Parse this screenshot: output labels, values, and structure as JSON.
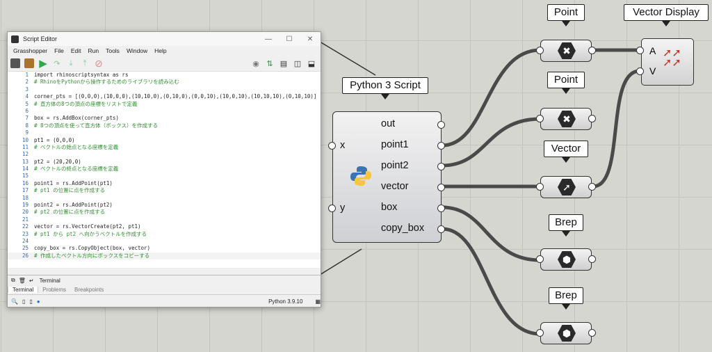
{
  "editor": {
    "title": "Script Editor",
    "menu": [
      "Grasshopper",
      "File",
      "Edit",
      "Run",
      "Tools",
      "Window",
      "Help"
    ],
    "code_lines": [
      {
        "n": "1",
        "t": "import rhinoscriptsyntax as rs"
      },
      {
        "n": "2",
        "t": "# RhinoをPythonから操作するためのライブラリを読み込む"
      },
      {
        "n": "3",
        "t": ""
      },
      {
        "n": "4",
        "t": "corner_pts = [(0,0,0),(10,0,0),(10,10,0),(0,10,0),(0,0,10),(10,0,10),(10,10,10),(0,10,10)]"
      },
      {
        "n": "5",
        "t": "# 直方体の8つの頂点の座標をリストで定義"
      },
      {
        "n": "6",
        "t": ""
      },
      {
        "n": "7",
        "t": "box = rs.AddBox(corner_pts)"
      },
      {
        "n": "8",
        "t": "# 8つの頂点を使って直方体（ボックス）を作成する"
      },
      {
        "n": "9",
        "t": ""
      },
      {
        "n": "10",
        "t": "pt1 = (0,0,0)"
      },
      {
        "n": "11",
        "t": "# ベクトルの始点となる座標を定義"
      },
      {
        "n": "12",
        "t": ""
      },
      {
        "n": "13",
        "t": "pt2 = (20,20,0)"
      },
      {
        "n": "14",
        "t": "# ベクトルの終点となる座標を定義"
      },
      {
        "n": "15",
        "t": ""
      },
      {
        "n": "16",
        "t": "point1 = rs.AddPoint(pt1)"
      },
      {
        "n": "17",
        "t": "# pt1 の位置に点を作成する"
      },
      {
        "n": "18",
        "t": ""
      },
      {
        "n": "19",
        "t": "point2 = rs.AddPoint(pt2)"
      },
      {
        "n": "20",
        "t": "# pt2 の位置に点を作成する"
      },
      {
        "n": "21",
        "t": ""
      },
      {
        "n": "22",
        "t": "vector = rs.VectorCreate(pt2, pt1)"
      },
      {
        "n": "23",
        "t": "# pt1 から pt2 へ向かうベクトルを作成する"
      },
      {
        "n": "24",
        "t": ""
      },
      {
        "n": "25",
        "t": "copy_box = rs.CopyObject(box, vector)"
      },
      {
        "n": "26",
        "t": "# 作成したベクトル方向にボックスをコピーする"
      }
    ],
    "terminal_label": "Terminal",
    "tabs": [
      "Terminal",
      "Problems",
      "Breakpoints"
    ],
    "python_version": "Python 3.9.10"
  },
  "python_component": {
    "title": "Python 3 Script",
    "inputs": [
      "x",
      "y"
    ],
    "outputs": [
      "out",
      "point1",
      "point2",
      "vector",
      "box",
      "copy_box"
    ]
  },
  "params": [
    {
      "label": "Point",
      "icon": "point-cross-icon"
    },
    {
      "label": "Point",
      "icon": "point-cross-icon"
    },
    {
      "label": "Vector",
      "icon": "vector-arrow-icon"
    },
    {
      "label": "Brep",
      "icon": "brep-icon"
    },
    {
      "label": "Brep",
      "icon": "brep-icon"
    }
  ],
  "vector_display": {
    "title": "Vector Display",
    "inputs": [
      "A",
      "V"
    ]
  },
  "colors": {
    "run_green": "#2ea84a",
    "wire": "#4a4a4a",
    "canvas": "#d6d6d0"
  }
}
